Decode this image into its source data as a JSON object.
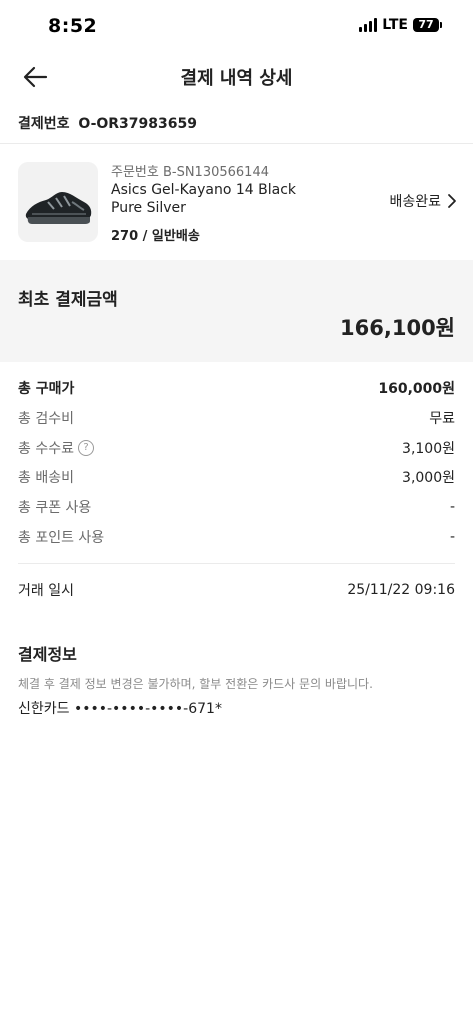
{
  "status_bar": {
    "time": "8:52",
    "network": "LTE",
    "battery": "77"
  },
  "header": {
    "title": "결제 내역 상세",
    "back_icon": "arrow-left-icon"
  },
  "payment_number": {
    "label": "결제번호",
    "value": "O-OR37983659"
  },
  "product": {
    "order_number": "주문번호 B-SN130566144",
    "name": "Asics Gel-Kayano 14 Black Pure Silver",
    "option": "270 / 일반배송",
    "status": "배송완료",
    "status_icon": "chevron-right-icon"
  },
  "total": {
    "label": "최초 결제금액",
    "value": "166,100원"
  },
  "breakdown": {
    "purchase": {
      "label": "총 구매가",
      "value": "160,000원"
    },
    "inspection": {
      "label": "총 검수비",
      "value": "무료"
    },
    "fee": {
      "label": "총 수수료",
      "value": "3,100원",
      "help": "?"
    },
    "shipping": {
      "label": "총 배송비",
      "value": "3,000원"
    },
    "coupon": {
      "label": "총 쿠폰 사용",
      "value": "-"
    },
    "points": {
      "label": "총 포인트 사용",
      "value": "-"
    }
  },
  "transaction": {
    "label": "거래 일시",
    "value": "25/11/22 09:16"
  },
  "payment_info": {
    "title": "결제정보",
    "notice": "체결 후 결제 정보 변경은 불가하며, 할부 전환은 카드사 문의 바랍니다.",
    "card": "신한카드 ••••-••••-••••-671*"
  },
  "colors": {
    "text": "#222222",
    "muted": "#6b6b6b",
    "panel_bg": "#f5f5f5",
    "divider": "#ebebeb"
  }
}
